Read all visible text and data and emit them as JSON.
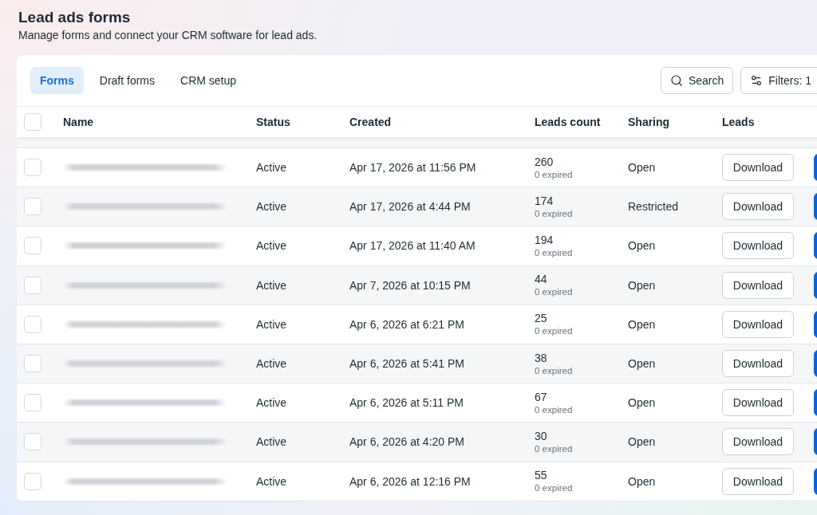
{
  "page": {
    "title": "Lead ads forms",
    "subtitle": "Manage forms and connect your CRM software for lead ads."
  },
  "tabs": [
    {
      "label": "Forms",
      "selected": true
    },
    {
      "label": "Draft forms",
      "selected": false
    },
    {
      "label": "CRM setup",
      "selected": false
    }
  ],
  "toolbar": {
    "search_label": "Search",
    "filters_label": "Filters: 1"
  },
  "table": {
    "select_all": {
      "checked": false
    },
    "columns": [
      "Name",
      "Status",
      "Created",
      "Leads count",
      "Sharing",
      "Leads"
    ],
    "rows": [
      {
        "checked": false,
        "status": "Active",
        "created": "Apr 17, 2026 at 11:56 PM",
        "leads_count": "260",
        "expired": "0 expired",
        "sharing": "Open",
        "leads_action": "Download"
      },
      {
        "checked": false,
        "status": "Active",
        "created": "Apr 17, 2026 at 4:44 PM",
        "leads_count": "174",
        "expired": "0 expired",
        "sharing": "Restricted",
        "leads_action": "Download"
      },
      {
        "checked": false,
        "status": "Active",
        "created": "Apr 17, 2026 at 11:40 AM",
        "leads_count": "194",
        "expired": "0 expired",
        "sharing": "Open",
        "leads_action": "Download"
      },
      {
        "checked": false,
        "status": "Active",
        "created": "Apr 7, 2026 at 10:15 PM",
        "leads_count": "44",
        "expired": "0 expired",
        "sharing": "Open",
        "leads_action": "Download"
      },
      {
        "checked": false,
        "status": "Active",
        "created": "Apr 6, 2026 at 6:21 PM",
        "leads_count": "25",
        "expired": "0 expired",
        "sharing": "Open",
        "leads_action": "Download"
      },
      {
        "checked": false,
        "status": "Active",
        "created": "Apr 6, 2026 at 5:41 PM",
        "leads_count": "38",
        "expired": "0 expired",
        "sharing": "Open",
        "leads_action": "Download"
      },
      {
        "checked": false,
        "status": "Active",
        "created": "Apr 6, 2026 at 5:11 PM",
        "leads_count": "67",
        "expired": "0 expired",
        "sharing": "Open",
        "leads_action": "Download"
      },
      {
        "checked": false,
        "status": "Active",
        "created": "Apr 6, 2026 at 4:20 PM",
        "leads_count": "30",
        "expired": "0 expired",
        "sharing": "Open",
        "leads_action": "Download"
      },
      {
        "checked": false,
        "status": "Active",
        "created": "Apr 6, 2026 at 12:16 PM",
        "leads_count": "55",
        "expired": "0 expired",
        "sharing": "Open",
        "leads_action": "Download"
      }
    ]
  }
}
